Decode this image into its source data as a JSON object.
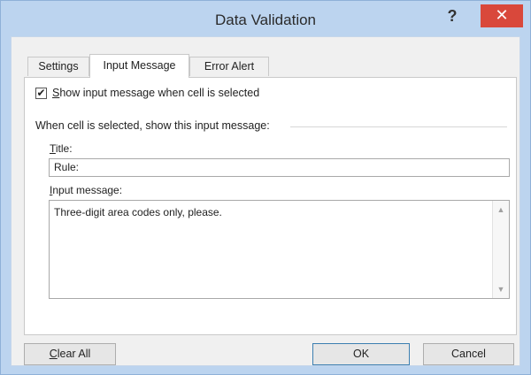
{
  "window": {
    "title": "Data Validation",
    "help_glyph": "?",
    "close_glyph": "✕"
  },
  "tabs": [
    {
      "label": "Settings",
      "active": false
    },
    {
      "label": "Input Message",
      "active": true
    },
    {
      "label": "Error Alert",
      "active": false
    }
  ],
  "input_message": {
    "show_checkbox": {
      "checked": true,
      "check_glyph": "✔",
      "label_mnemonic": "S",
      "label_rest": "how input message when cell is selected"
    },
    "group_label": "When cell is selected, show this input message:",
    "title_label_mnemonic": "T",
    "title_label_rest": "itle:",
    "title_value": "Rule:",
    "message_label_mnemonic": "I",
    "message_label_rest": "nput message:",
    "message_value": "Three-digit area codes only, please."
  },
  "buttons": {
    "clear_all_mnemonic": "C",
    "clear_all_rest": "lear All",
    "ok": "OK",
    "cancel": "Cancel"
  },
  "icons": {
    "scroll_up": "▲",
    "scroll_down": "▼"
  },
  "colors": {
    "frame": "#bcd4ef",
    "close_button": "#d9483b",
    "default_button_border": "#3c7fb1"
  }
}
